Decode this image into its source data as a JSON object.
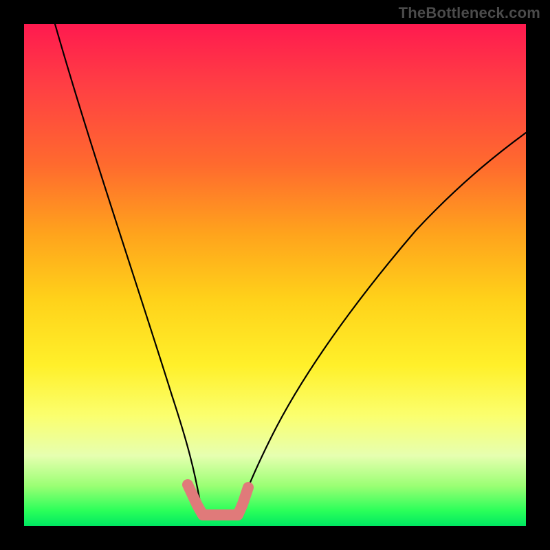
{
  "watermark": "TheBottleneck.com",
  "chart_data": {
    "type": "line",
    "title": "",
    "xlabel": "",
    "ylabel": "",
    "xlim": [
      0,
      100
    ],
    "ylim": [
      0,
      100
    ],
    "grid": false,
    "legend": false,
    "series": [
      {
        "name": "left-curve",
        "x": [
          6,
          12,
          18,
          24,
          28,
          30,
          32,
          33.5,
          35
        ],
        "y": [
          100,
          80,
          58,
          36,
          20,
          12,
          6,
          3,
          2
        ]
      },
      {
        "name": "right-curve",
        "x": [
          42,
          44,
          48,
          55,
          65,
          78,
          90,
          100
        ],
        "y": [
          2,
          4,
          10,
          22,
          40,
          58,
          70,
          78
        ]
      },
      {
        "name": "highlighted-valley",
        "x": [
          32,
          33,
          34,
          35,
          36,
          38,
          40,
          41,
          42,
          43
        ],
        "y": [
          7,
          4,
          2.5,
          2,
          2,
          2,
          2,
          2.5,
          4,
          7
        ]
      }
    ],
    "colors": {
      "curve": "#000000",
      "highlight": "#e07a7a",
      "gradient_top": "#ff1a4f",
      "gradient_bottom": "#00e861"
    }
  }
}
